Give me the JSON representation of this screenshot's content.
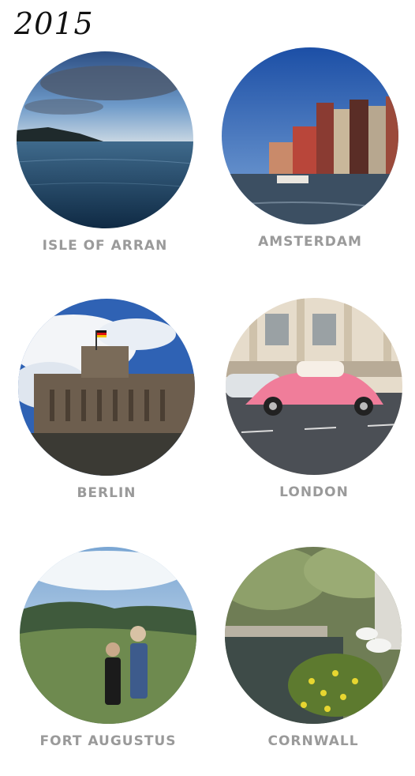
{
  "year": "2015",
  "places": [
    {
      "name": "ISLE OF ARRAN"
    },
    {
      "name": "AMSTERDAM"
    },
    {
      "name": "BERLIN"
    },
    {
      "name": "LONDON"
    },
    {
      "name": "FORT AUGUSTUS"
    },
    {
      "name": "CORNWALL"
    }
  ]
}
